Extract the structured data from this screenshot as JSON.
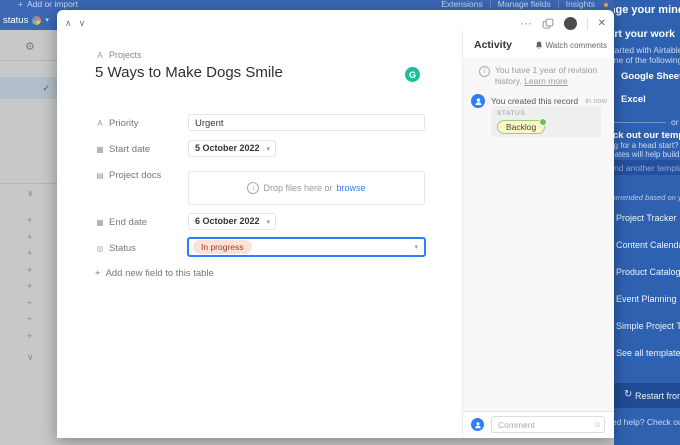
{
  "topbar": {
    "plus": "+",
    "add_import": "Add or import",
    "menus": [
      "Extensions",
      "Manage fields",
      "Insights"
    ],
    "status_view": "status"
  },
  "modal": {
    "primary_field_label": "Projects",
    "title": "5 Ways to Make Dogs Smile",
    "grammarly": "G",
    "fields": [
      {
        "icon": "text-field-icon",
        "label": "Priority",
        "value": "Urgent"
      },
      {
        "icon": "calendar-icon",
        "label": "Start date",
        "value": "5 October 2022"
      },
      {
        "icon": "file-icon",
        "label": "Project docs",
        "dropzone_text": "Drop files here or",
        "browse_label": "browse"
      },
      {
        "icon": "calendar-icon",
        "label": "End date",
        "value": "6 October 2022"
      },
      {
        "icon": "status-field-icon",
        "label": "Status",
        "value": "In progress"
      }
    ],
    "add_field_plus": "+",
    "add_field_label": "Add new field to this table"
  },
  "activity": {
    "title": "Activity",
    "watch_label": "Watch comments",
    "revision_text": "You have 1 year of revision history.",
    "learn_more": "Learn more",
    "entry": {
      "actor_text": "You created this record",
      "time": "in now",
      "field_label": "STATUS",
      "value": "Backlog"
    },
    "comment_placeholder": "Comment"
  },
  "onboarding": {
    "heading": "Change your mind?",
    "subheading": "Start your work",
    "body_line1": "Get started with Airtable using",
    "body_line2": "one of the following templates",
    "import_buttons": [
      "Google Sheets",
      "Excel"
    ],
    "or_label": "or",
    "templates_heading": "Check out our templates",
    "templates_body_line1": "Looking for a head start? Our",
    "templates_body_line2": "templates will help build your base",
    "search_placeholder": "Find another template",
    "recommended_label": "Recommended based on your use case",
    "template_links": [
      "Project Tracker",
      "Content Calendar",
      "Product Catalog",
      "Event Planning",
      "Simple Project Tracker"
    ],
    "see_all_label": "See all templates",
    "restart_icon": "↻",
    "restart_label": "Restart from scratch",
    "footer": "Need help? Check out our guides"
  },
  "colors": {
    "accent_blue": "#2d7ff9",
    "topbar_blue": "#3c68b5",
    "sidebar_blue": "#2e62b1",
    "restart_blue": "#1f4c94",
    "in_progress_pill_bg": "#fee2d5",
    "backlog_pill_bg": "#fbf6c3",
    "grammarly_green": "#15c39a"
  }
}
